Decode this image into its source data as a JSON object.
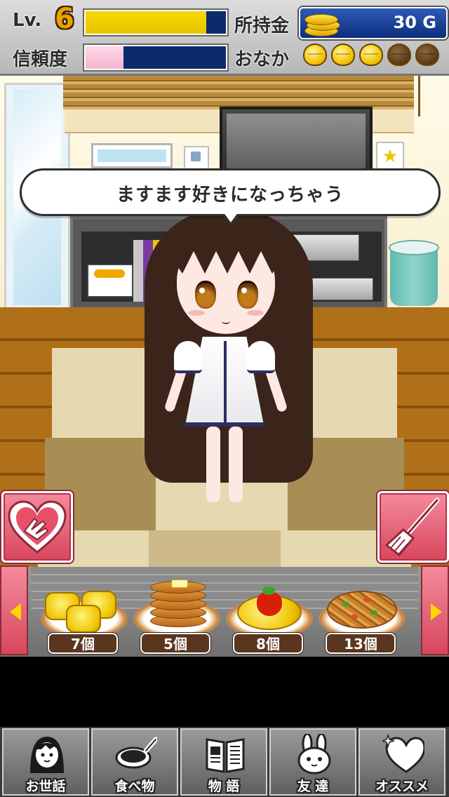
{
  "status": {
    "level_label": "Lv.",
    "level_value": "6",
    "level_progress": 0.86,
    "money_label": "所持金",
    "money_value": "30 G",
    "trust_label": "信頼度",
    "trust_progress": 0.27,
    "hunger_label": "おなか",
    "hunger_full": 3,
    "hunger_max": 5
  },
  "speech": "ますます好きになっちゃう",
  "actions": {
    "left_icon": "heart-hand-icon",
    "right_icon": "broom-icon"
  },
  "food_items": [
    {
      "icon": "tamagoyaki-icon",
      "count": "7個"
    },
    {
      "icon": "pancake-icon",
      "count": "5個"
    },
    {
      "icon": "omurice-icon",
      "count": "8個"
    },
    {
      "icon": "yakisoba-icon",
      "count": "13個"
    }
  ],
  "nav": [
    {
      "label": "お世話",
      "icon": "girl-face-icon",
      "active": true
    },
    {
      "label": "食べ物",
      "icon": "frying-pan-icon",
      "active": false
    },
    {
      "label": "物 語",
      "icon": "book-icon",
      "active": false
    },
    {
      "label": "友 達",
      "icon": "rabbit-icon",
      "active": false
    },
    {
      "label": "オススメ",
      "icon": "heart-sparkle-icon",
      "active": false
    }
  ],
  "colors": {
    "level_bar": "#f5d800",
    "trust_bar": "#f4b4cf",
    "bar_bg": "#0c2b6a",
    "accent_pink": "#e05a70"
  }
}
